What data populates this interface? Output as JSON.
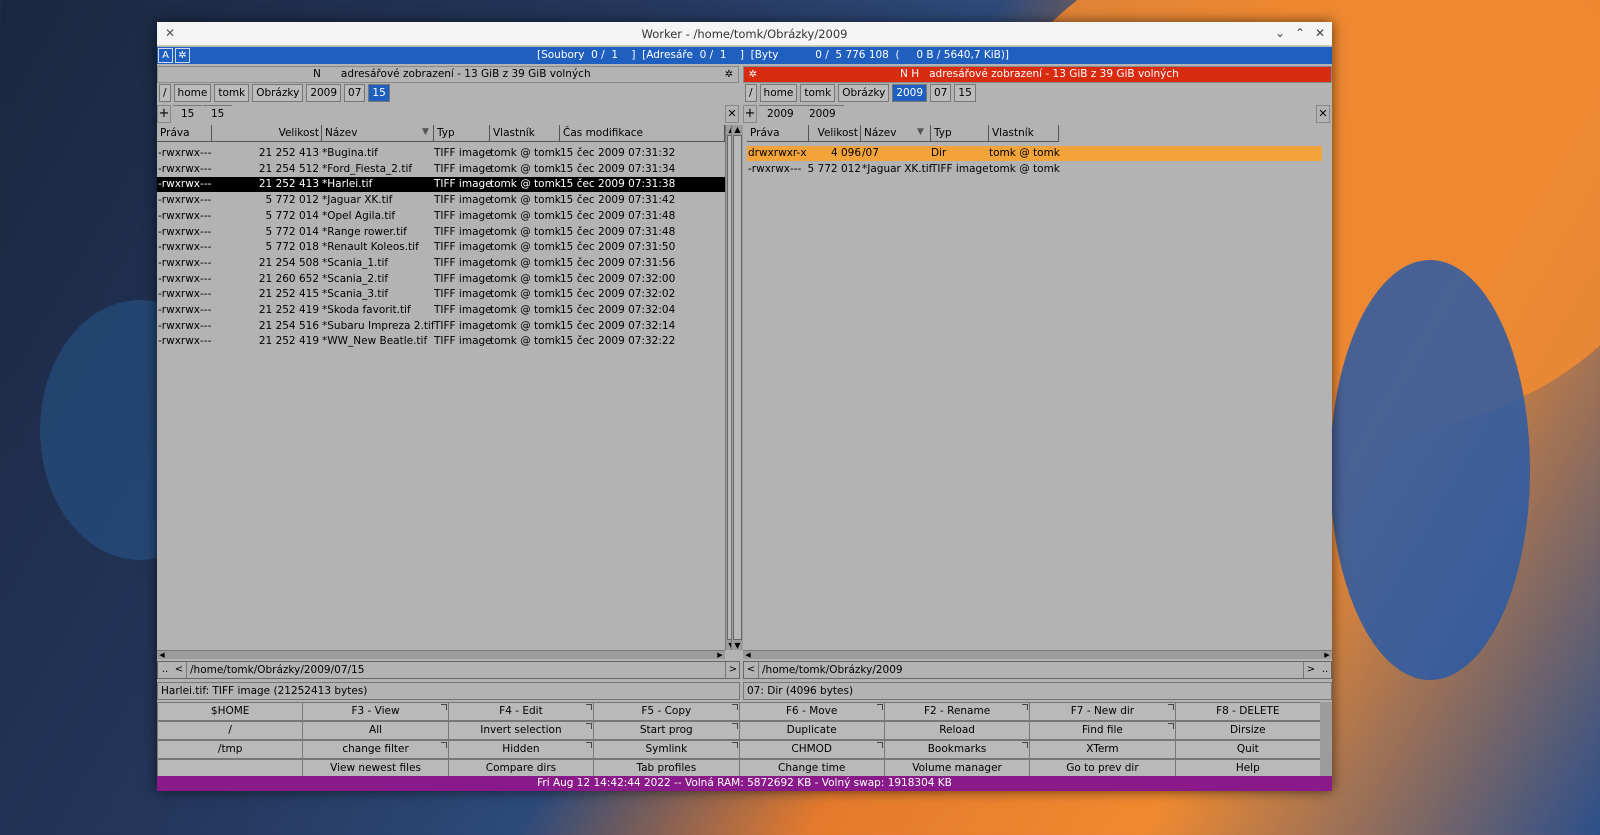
{
  "window": {
    "title": "Worker - /home/tomk/Obrázky/2009"
  },
  "infobar": {
    "a_label": "A",
    "text": "[Soubory  0 /  1    ]  [Adresáře  0 /  1    ]  [Byty           0 /  5 776 108  (     0 B / 5640,7 KiB)]"
  },
  "left": {
    "header": "N      adresářové zobrazení - 13 GiB z 39 GiB volných",
    "breadcrumbs": [
      "/",
      "home",
      "tomk",
      "Obrázky",
      "2009",
      "07",
      "15"
    ],
    "selected_crumb": 6,
    "tabs": [
      "15",
      "15"
    ],
    "columns": [
      "Práva",
      "Velikost",
      "Název",
      "Typ",
      "Vlastník",
      "Čas modifikace"
    ],
    "rows": [
      {
        "perm": "-rwxrwx---",
        "size": "21 252 413",
        "name": "*Bugina.tif",
        "type": "TIFF image",
        "owner": "tomk @ tomk",
        "time": "15 čec 2009 07:31:32"
      },
      {
        "perm": "-rwxrwx---",
        "size": "21 254 512",
        "name": "*Ford_Fiesta_2.tif",
        "type": "TIFF image",
        "owner": "tomk @ tomk",
        "time": "15 čec 2009 07:31:34"
      },
      {
        "perm": "-rwxrwx---",
        "size": "21 252 413",
        "name": "*Harlei.tif",
        "type": "TIFF image",
        "owner": "tomk @ tomk",
        "time": "15 čec 2009 07:31:38"
      },
      {
        "perm": "-rwxrwx---",
        "size": "5 772 012",
        "name": "*Jaguar XK.tif",
        "type": "TIFF image",
        "owner": "tomk @ tomk",
        "time": "15 čec 2009 07:31:42"
      },
      {
        "perm": "-rwxrwx---",
        "size": "5 772 014",
        "name": "*Opel Agila.tif",
        "type": "TIFF image",
        "owner": "tomk @ tomk",
        "time": "15 čec 2009 07:31:48"
      },
      {
        "perm": "-rwxrwx---",
        "size": "5 772 014",
        "name": "*Range rower.tif",
        "type": "TIFF image",
        "owner": "tomk @ tomk",
        "time": "15 čec 2009 07:31:48"
      },
      {
        "perm": "-rwxrwx---",
        "size": "5 772 018",
        "name": "*Renault Koleos.tif",
        "type": "TIFF image",
        "owner": "tomk @ tomk",
        "time": "15 čec 2009 07:31:50"
      },
      {
        "perm": "-rwxrwx---",
        "size": "21 254 508",
        "name": "*Scania_1.tif",
        "type": "TIFF image",
        "owner": "tomk @ tomk",
        "time": "15 čec 2009 07:31:56"
      },
      {
        "perm": "-rwxrwx---",
        "size": "21 260 652",
        "name": "*Scania_2.tif",
        "type": "TIFF image",
        "owner": "tomk @ tomk",
        "time": "15 čec 2009 07:32:00"
      },
      {
        "perm": "-rwxrwx---",
        "size": "21 252 415",
        "name": "*Scania_3.tif",
        "type": "TIFF image",
        "owner": "tomk @ tomk",
        "time": "15 čec 2009 07:32:02"
      },
      {
        "perm": "-rwxrwx---",
        "size": "21 252 419",
        "name": "*Skoda favorit.tif",
        "type": "TIFF image",
        "owner": "tomk @ tomk",
        "time": "15 čec 2009 07:32:04"
      },
      {
        "perm": "-rwxrwx---",
        "size": "21 254 516",
        "name": "*Subaru Impreza 2.tif",
        "type": "TIFF image",
        "owner": "tomk @ tomk",
        "time": "15 čec 2009 07:32:14"
      },
      {
        "perm": "-rwxrwx---",
        "size": "21 252 419",
        "name": "*WW_New Beatle.tif",
        "type": "TIFF image",
        "owner": "tomk @ tomk",
        "time": "15 čec 2009 07:32:22"
      }
    ],
    "current_row": 2,
    "path": "/home/tomk/Obrázky/2009/07/15",
    "status": "Harlei.tif: TIFF image (21252413 bytes)"
  },
  "right": {
    "header": "N H   adresářové zobrazení - 13 GiB z 39 GiB volných",
    "breadcrumbs": [
      "/",
      "home",
      "tomk",
      "Obrázky",
      "2009",
      "07",
      "15"
    ],
    "selected_crumb": 4,
    "tabs": [
      "2009",
      "2009"
    ],
    "columns": [
      "Práva",
      "Velikost",
      "Název",
      "Typ",
      "Vlastník"
    ],
    "rows": [
      {
        "perm": "drwxrwxr-x",
        "size": "4 096",
        "name": "/07",
        "type": "Dir",
        "owner": "tomk @ tomk"
      },
      {
        "perm": "-rwxrwx---",
        "size": "5 772 012",
        "name": "*Jaguar XK.tif",
        "type": "TIFF image",
        "owner": "tomk @ tomk"
      }
    ],
    "highlight_row": 0,
    "path": "/home/tomk/Obrázky/2009",
    "status": "07: Dir (4096 bytes)"
  },
  "buttons": [
    [
      "$HOME",
      "F3 - View",
      "F4 - Edit",
      "F5 - Copy",
      "F6 - Move",
      "F2 - Rename",
      "F7 - New dir",
      "F8 - DELETE"
    ],
    [
      "/",
      "All",
      "Invert selection",
      "Start prog",
      "Duplicate",
      "Reload",
      "Find file",
      "Dirsize"
    ],
    [
      "/tmp",
      "change filter",
      "Hidden",
      "Symlink",
      "CHMOD",
      "Bookmarks",
      "XTerm",
      "Quit"
    ],
    [
      "",
      "View newest files",
      "Compare dirs",
      "Tab profiles",
      "Change time",
      "Volume manager",
      "Go to prev dir",
      "Help"
    ]
  ],
  "footer": "Fri Aug 12 14:42:44 2022  --  Volná RAM: 5872692 KB  -  Volný swap: 1918304 KB",
  "colors": {
    "accent": "#1f5fbf",
    "active_header": "#d92b10",
    "footer": "#8a1a8a",
    "highlight": "#f2a43a"
  }
}
